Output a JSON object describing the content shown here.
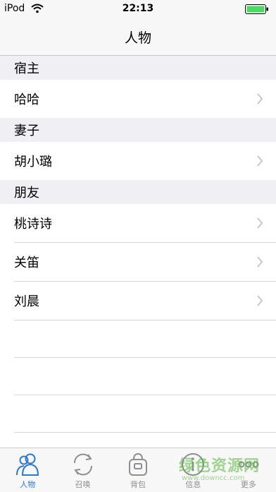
{
  "status": {
    "carrier": "iPod",
    "time": "22:13",
    "battery_color": "#4cd964"
  },
  "nav": {
    "title": "人物"
  },
  "sections": [
    {
      "header": "宿主",
      "rows": [
        "哈哈"
      ]
    },
    {
      "header": "妻子",
      "rows": [
        "胡小璐"
      ]
    },
    {
      "header": "朋友",
      "rows": [
        "桃诗诗",
        "关笛",
        "刘晨"
      ]
    }
  ],
  "tabs": [
    {
      "label": "人物",
      "icon": "people-icon",
      "active": true
    },
    {
      "label": "召唤",
      "icon": "refresh-icon",
      "active": false
    },
    {
      "label": "背包",
      "icon": "bag-icon",
      "active": false
    },
    {
      "label": "信息",
      "icon": "info-icon",
      "active": false
    },
    {
      "label": "更多",
      "icon": "more-icon",
      "active": false
    }
  ],
  "watermark": {
    "text": "绿色资源网",
    "url": "www.downcc.com"
  },
  "colors": {
    "accent": "#2a78d8",
    "inactive": "#8e8e93",
    "section_bg": "#efeff4"
  }
}
